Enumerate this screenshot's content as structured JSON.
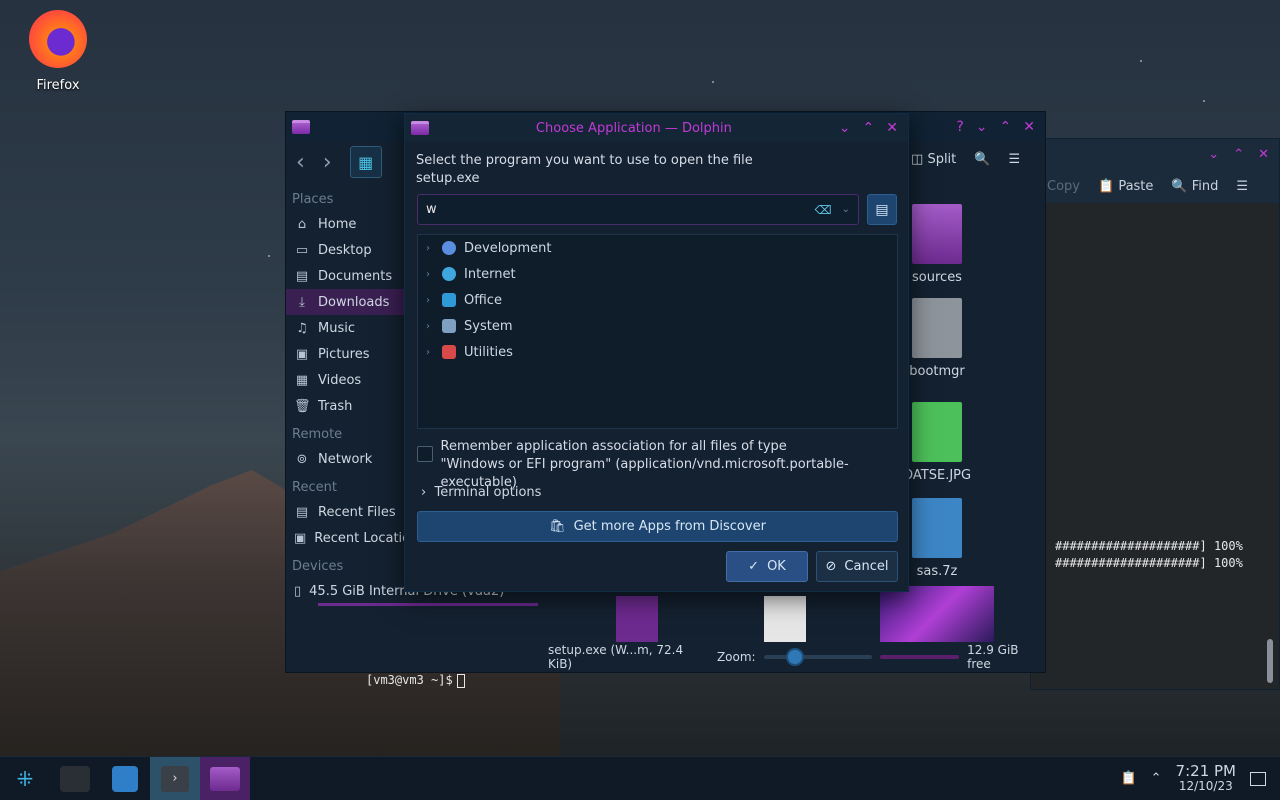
{
  "desktop": {
    "firefox_label": "Firefox"
  },
  "terminal": {
    "toolbar": {
      "copy": "Copy",
      "paste": "Paste",
      "find": "Find"
    },
    "lines": [
      "####################] 100%",
      "####################] 100%"
    ],
    "prompt": "[vm3@vm3 ~]$"
  },
  "dolphin": {
    "toolbar": {
      "split": "Split"
    },
    "sidebar": {
      "places_header": "Places",
      "places": [
        "Home",
        "Desktop",
        "Documents",
        "Downloads",
        "Music",
        "Pictures",
        "Videos",
        "Trash"
      ],
      "remote_header": "Remote",
      "remote": [
        "Network"
      ],
      "recent_header": "Recent",
      "recent": [
        "Recent Files",
        "Recent Locatio"
      ],
      "devices_header": "Devices",
      "devices": [
        "45.5 GiB Internal Drive (vda2)"
      ]
    },
    "files": [
      "sources",
      "bootmgr",
      "OATSE.JPG",
      "sas.7z"
    ],
    "status": {
      "selection": "setup.exe (W...m, 72.4 KiB)",
      "zoom_label": "Zoom:",
      "free": "12.9 GiB free"
    }
  },
  "dialog": {
    "title": "Choose Application — Dolphin",
    "prompt_line1": "Select the program you want to use to open the file",
    "prompt_line2": "setup.exe",
    "search_value": "w",
    "categories": [
      "Development",
      "Internet",
      "Office",
      "System",
      "Utilities"
    ],
    "remember_line1": "Remember application association for all files of type",
    "remember_line2": "\"Windows or EFI program\" (application/vnd.microsoft.portable-executable)",
    "terminal_options": "Terminal options",
    "discover_button": "Get more Apps from Discover",
    "ok_button": "OK",
    "cancel_button": "Cancel"
  },
  "taskbar": {
    "time": "7:21 PM",
    "date": "12/10/23"
  },
  "colors": {
    "accent_magenta": "#c23ad6",
    "button_blue": "#1d4570",
    "panel_bg": "#142130"
  }
}
